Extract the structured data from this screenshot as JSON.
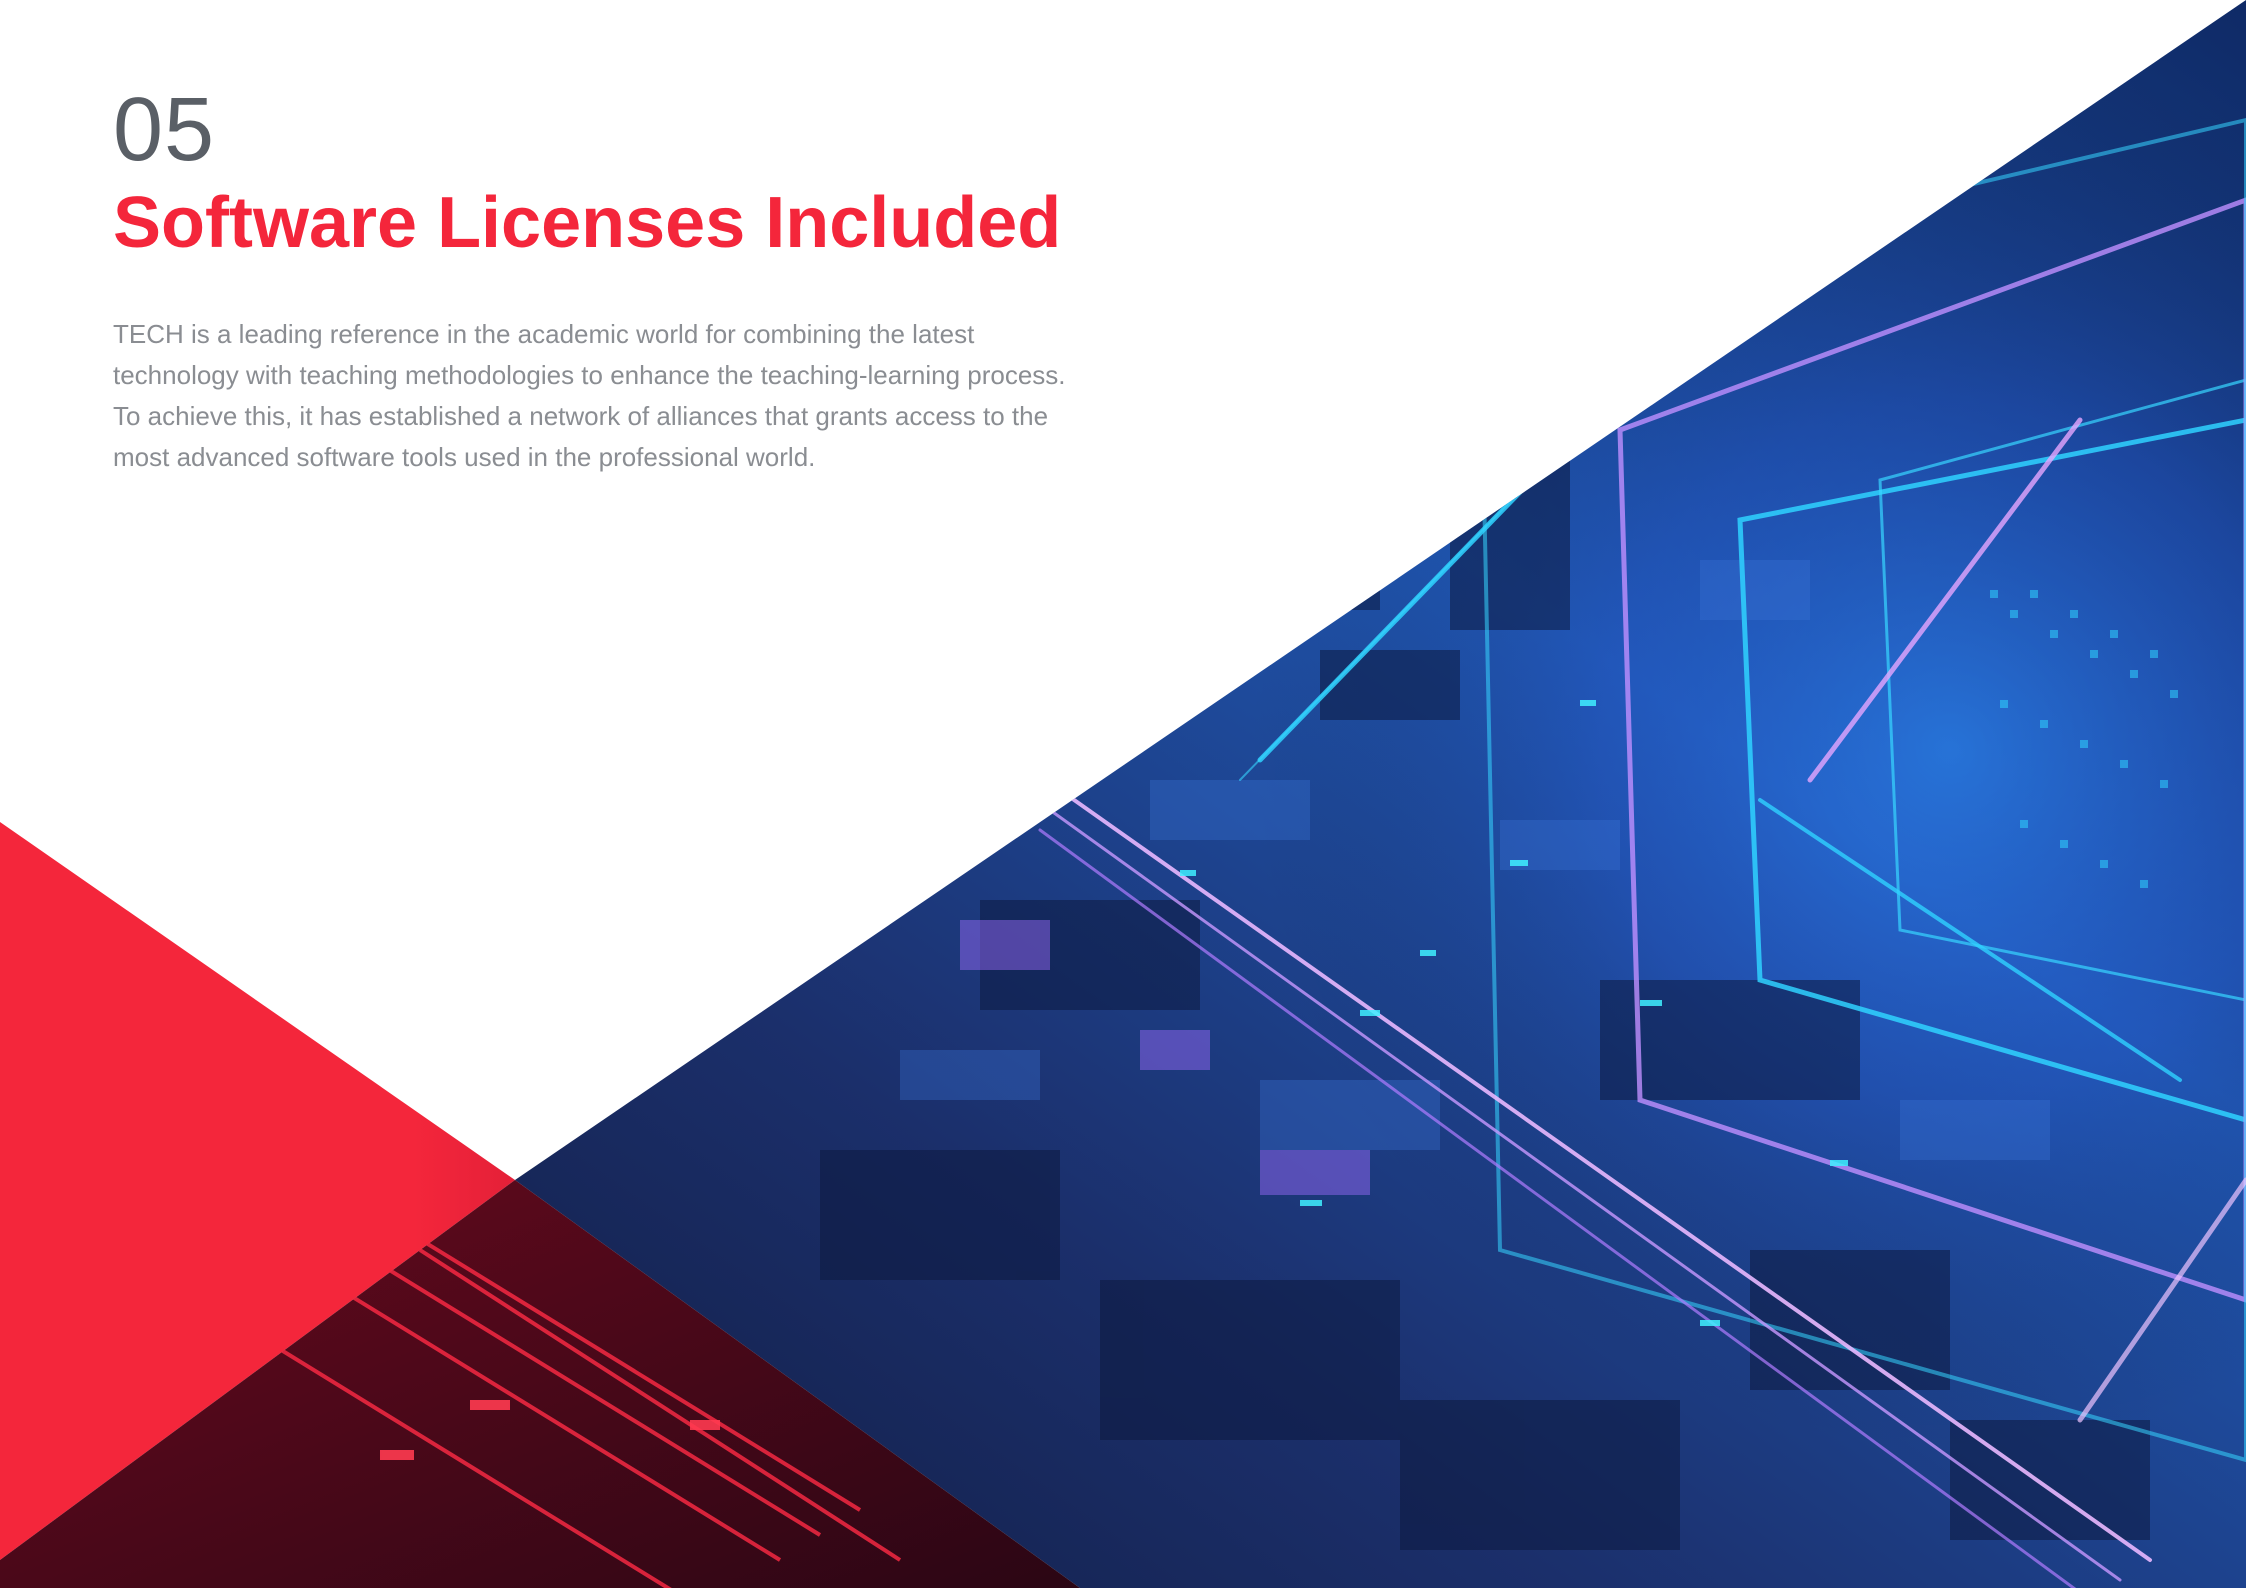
{
  "section": {
    "number": "05",
    "title": "Software Licenses Included",
    "intro": "TECH is a leading reference in the academic world for combining the latest technology with teaching methodologies to enhance the teaching-learning process. To achieve this, it has established a network of alliances that grants access to the most advanced software tools used in the professional world."
  },
  "colors": {
    "accent_red": "#f4263b",
    "number_gray": "#5a5f66",
    "body_gray": "#8a8d92",
    "art_blue": "#1e4fa8",
    "art_cyan": "#37d6ff",
    "art_violet": "#b07cff"
  },
  "decorations": {
    "art_panel": "tech-circuit-tunnel-image",
    "corner_accent": "red-triangle-accent"
  }
}
